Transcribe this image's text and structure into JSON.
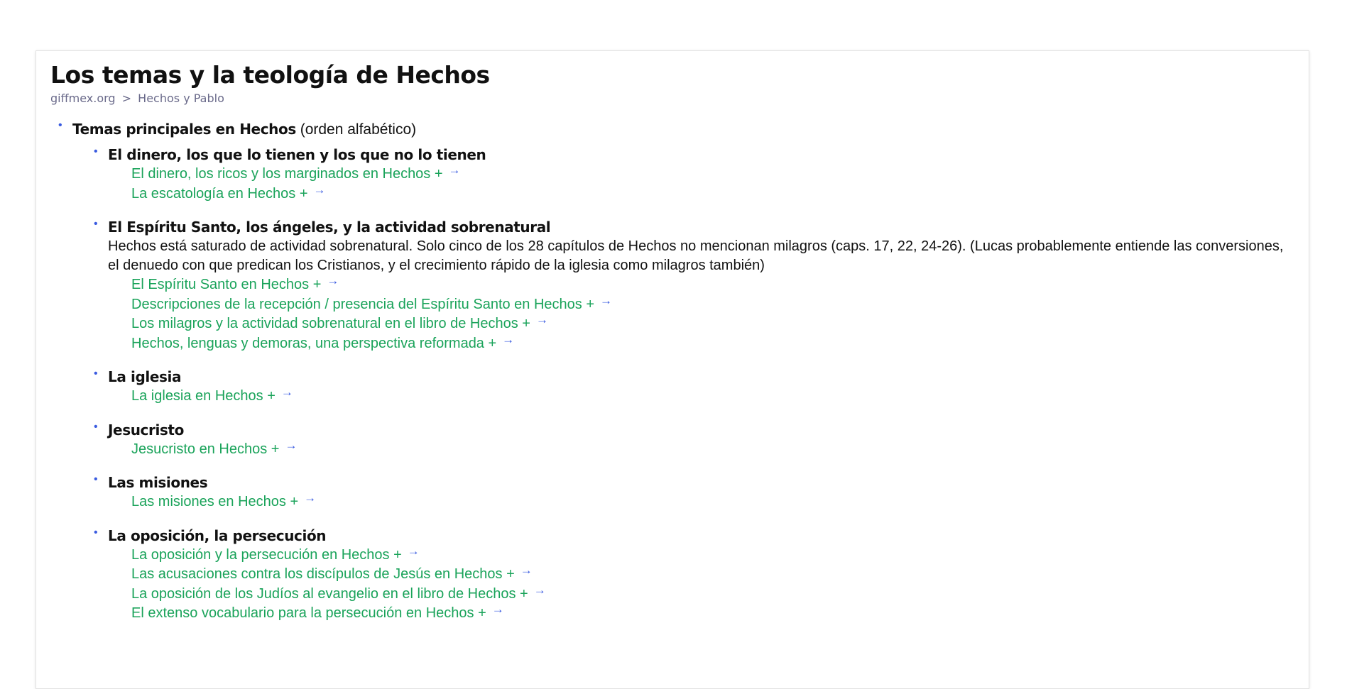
{
  "title": "Los temas y la teología de Hechos",
  "breadcrumb": {
    "home": "giffmex.org",
    "separator": ">",
    "current": "Hechos y Pablo"
  },
  "arrow_glyph": "→",
  "section": {
    "heading_bold": "Temas principales en Hechos",
    "heading_rest": "(orden alfabético)",
    "topics": [
      {
        "heading": "El dinero, los que lo tienen y los que no lo tienen",
        "links": [
          "El dinero, los ricos y los marginados en Hechos +",
          "La escatología en Hechos +"
        ]
      },
      {
        "heading": "El Espíritu Santo, los ángeles, y la actividad sobrenatural",
        "description": "Hechos está saturado de actividad sobrenatural. Solo cinco de los 28 capítulos de Hechos no mencionan milagros (caps. 17, 22, 24-26). (Lucas probablemente entiende las conversiones, el denuedo con que predican los Cristianos, y el crecimiento rápido de la iglesia como milagros también)",
        "links": [
          "El Espíritu Santo en Hechos +",
          "Descripciones de la recepción / presencia del Espíritu Santo en Hechos +",
          "Los milagros y la actividad sobrenatural en el libro de Hechos +",
          "Hechos, lenguas y demoras, una perspectiva reformada +"
        ]
      },
      {
        "heading": "La iglesia",
        "links": [
          "La iglesia en Hechos +"
        ]
      },
      {
        "heading": "Jesucristo",
        "links": [
          "Jesucristo en Hechos +"
        ]
      },
      {
        "heading": "Las misiones",
        "links": [
          "Las misiones en Hechos +"
        ]
      },
      {
        "heading": "La oposición, la persecución",
        "links": [
          "La oposición y la persecución en Hechos +",
          "Las acusaciones contra los discípulos de Jesús en Hechos +",
          "La oposición de los Judíos al evangelio en el libro de Hechos +",
          "El extenso vocabulario para la persecución en Hechos +"
        ]
      }
    ]
  },
  "colors": {
    "link": "#1aa35a",
    "bullet": "#3a5be0",
    "arrow": "#3a5be0",
    "breadcrumb": "#6a6a8a",
    "text": "#111111"
  }
}
